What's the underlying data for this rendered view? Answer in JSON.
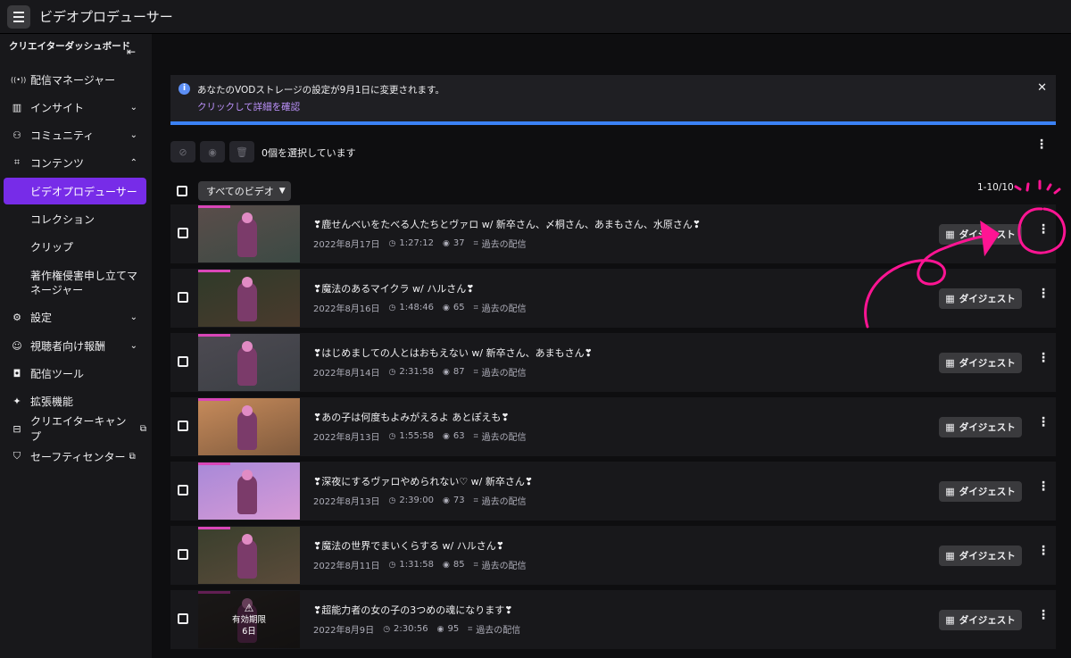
{
  "app": {
    "title": "ビデオプロデューサー"
  },
  "sidebar": {
    "heading": "クリエイターダッシュボード",
    "items": [
      {
        "label": "配信マネージャー",
        "icon": "broadcast-icon",
        "glyph": "((•))"
      },
      {
        "label": "インサイト",
        "icon": "chart-icon",
        "glyph": "▥"
      },
      {
        "label": "コミュニティ",
        "icon": "community-icon",
        "glyph": "⚇"
      },
      {
        "label": "コンテンツ",
        "icon": "content-icon",
        "glyph": "⌗"
      },
      {
        "label": "設定",
        "icon": "gear-icon",
        "glyph": "⚙"
      },
      {
        "label": "視聴者向け報酬",
        "icon": "reward-icon",
        "glyph": "☺"
      },
      {
        "label": "配信ツール",
        "icon": "camera-icon",
        "glyph": "◘"
      },
      {
        "label": "拡張機能",
        "icon": "puzzle-icon",
        "glyph": "✦"
      },
      {
        "label": "クリエイターキャンプ",
        "icon": "book-icon",
        "glyph": "⊟"
      },
      {
        "label": "セーフティセンター",
        "icon": "shield-icon",
        "glyph": "⛉"
      }
    ],
    "content_sub": [
      "ビデオプロデューサー",
      "コレクション",
      "クリップ",
      "著作権侵害申し立てマネージャー"
    ]
  },
  "banner": {
    "message": "あなたのVODストレージの設定が9月1日に変更されます。",
    "link": "クリックして詳細を確認"
  },
  "toolbar": {
    "selected": "0個を選択しています"
  },
  "list": {
    "filter": "すべてのビデオ",
    "range": "1-10/10",
    "digest_label": "ダイジェスト",
    "past_broadcast": "過去の配信",
    "expire_label": "有効期限",
    "expire_days": "6日",
    "videos": [
      {
        "title": "❣鹿せんべいをたべる人たちとヴァロ w/ 新卒さん、〆桐さん、あまもさん、水原さん❣",
        "date": "2022年8月17日",
        "duration": "1:27:12",
        "views": "37"
      },
      {
        "title": "❣魔法のあるマイクラ w/ ハルさん❣",
        "date": "2022年8月16日",
        "duration": "1:48:46",
        "views": "65"
      },
      {
        "title": "❣はじめましての人とはおもえない w/ 新卒さん、あまもさん❣",
        "date": "2022年8月14日",
        "duration": "2:31:58",
        "views": "87"
      },
      {
        "title": "❣あの子は何度もよみがえるよ あとぽえも❣",
        "date": "2022年8月13日",
        "duration": "1:55:58",
        "views": "63"
      },
      {
        "title": "❣深夜にするヴァロやめられない♡ w/ 新卒さん❣",
        "date": "2022年8月13日",
        "duration": "2:39:00",
        "views": "73"
      },
      {
        "title": "❣魔法の世界でまいくらする w/ ハルさん❣",
        "date": "2022年8月11日",
        "duration": "1:31:58",
        "views": "85"
      },
      {
        "title": "❣超能力者の女の子の3つめの魂になります❣",
        "date": "2022年8月9日",
        "duration": "2:30:56",
        "views": "95"
      }
    ]
  },
  "colors": {
    "accent": "#772ce8",
    "link": "#bf94ff",
    "banner_line": "#3b82f6",
    "annotation": "#ff1493"
  }
}
